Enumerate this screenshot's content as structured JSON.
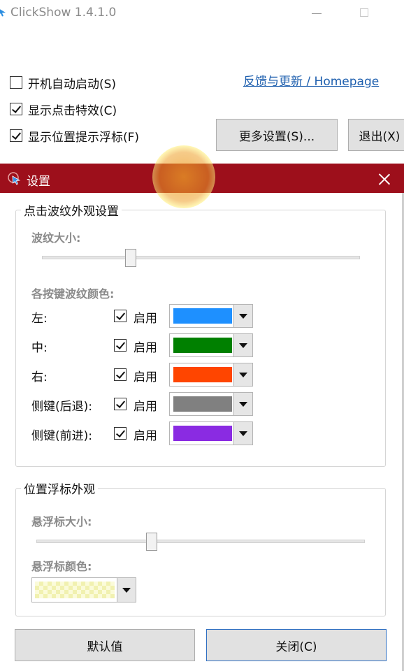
{
  "window": {
    "title": "ClickShow 1.4.1.0",
    "autostart_label": "开机自动启动(S)",
    "autostart_checked": false,
    "show_click_label": "显示点击特效(C)",
    "show_click_checked": true,
    "show_float_label": "显示位置提示浮标(F)",
    "show_float_checked": true,
    "homepage_link": "反馈与更新 / Homepage",
    "more_settings_label": "更多设置(S)...",
    "exit_label": "退出(X)"
  },
  "dialog": {
    "title": "设置",
    "ripple_group": {
      "legend": "点击波纹外观设置",
      "size_label": "波纹大小:",
      "size_value_fraction": 0.28,
      "colors_label": "各按键波纹颜色:",
      "buttons": [
        {
          "label": "左:",
          "enable_label": "启用",
          "enabled": true,
          "color": "#1E90FF"
        },
        {
          "label": "中:",
          "enable_label": "启用",
          "enabled": true,
          "color": "#008000"
        },
        {
          "label": "右:",
          "enable_label": "启用",
          "enabled": true,
          "color": "#FF4500"
        },
        {
          "label": "侧键(后退):",
          "enable_label": "启用",
          "enabled": true,
          "color": "#808080"
        },
        {
          "label": "侧键(前进):",
          "enable_label": "启用",
          "enabled": true,
          "color": "#8A2BE2"
        }
      ]
    },
    "float_group": {
      "legend": "位置浮标外观",
      "size_label": "悬浮标大小:",
      "size_value_fraction": 0.35,
      "color_label": "悬浮标颜色:",
      "color": "#FFFFC0"
    },
    "default_button": "默认值",
    "close_button": "关闭(C)"
  },
  "colors": {
    "dialog_title_bg": "#9D0F1B",
    "link": "#1E5FAE"
  }
}
